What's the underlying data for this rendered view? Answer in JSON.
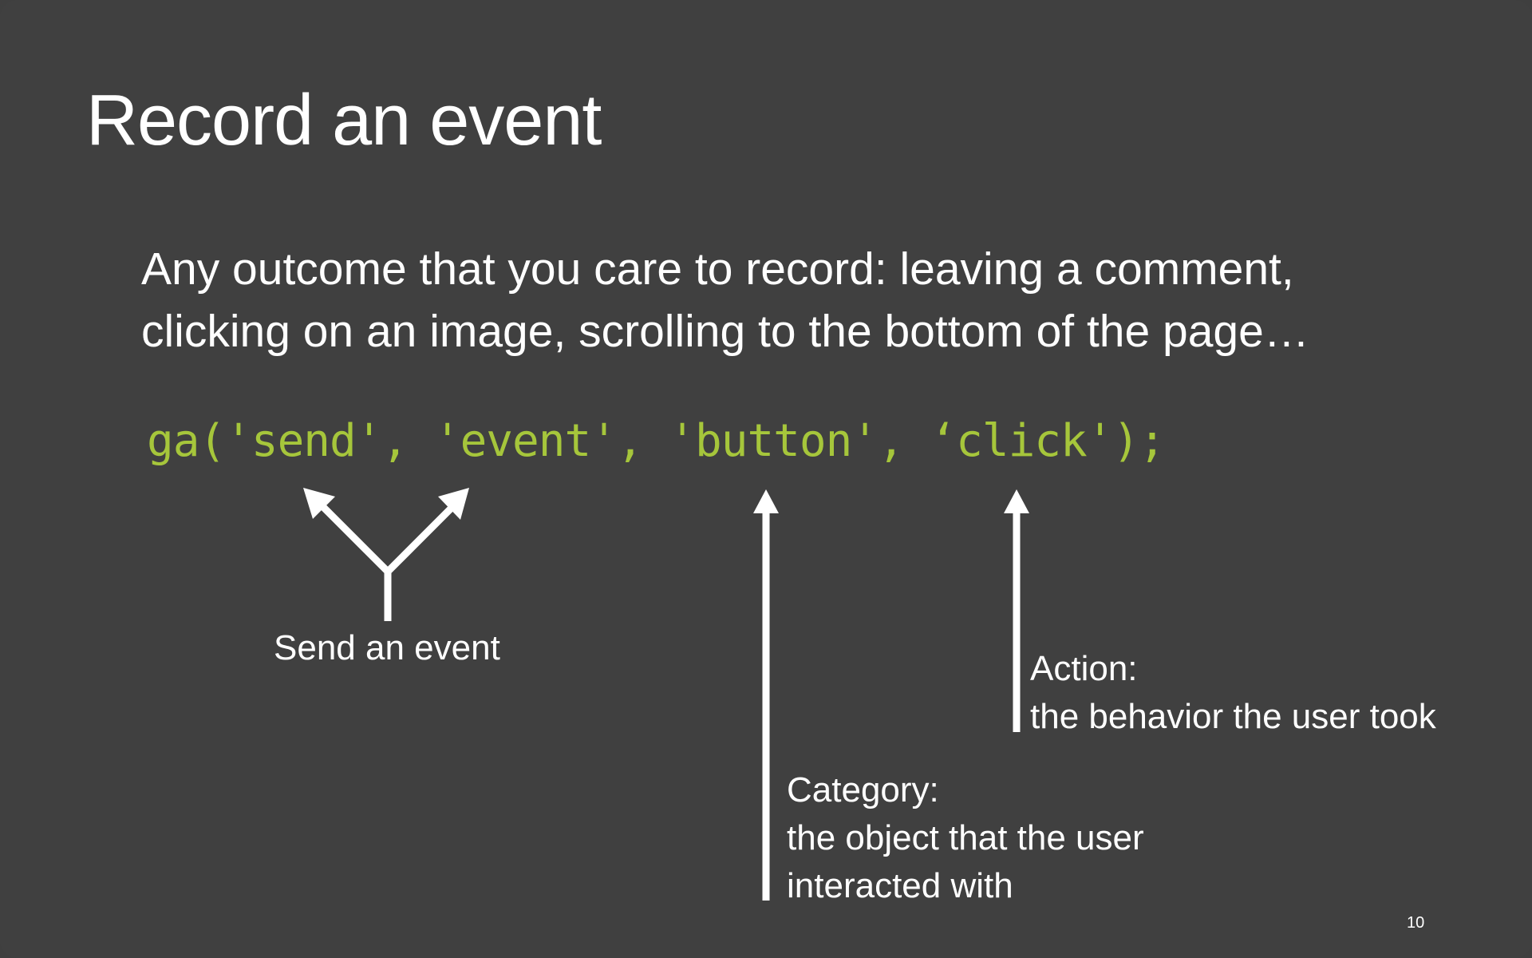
{
  "slide": {
    "title": "Record an event",
    "body_line1": "Any outcome that you care to record: leaving a comment,",
    "body_line2": "clicking on an image, scrolling to the bottom of the page…",
    "code": "ga('send', 'event', 'button', ‘click');",
    "send_label": "Send an event",
    "action_label_line1": "Action:",
    "action_label_line2": "the behavior the user took",
    "category_label_line1": "Category:",
    "category_label_line2": "the object that the user",
    "category_label_line3": "interacted with",
    "page_number": "10"
  },
  "colors": {
    "background": "#404040",
    "text": "#ffffff",
    "code": "#a6c63b"
  }
}
